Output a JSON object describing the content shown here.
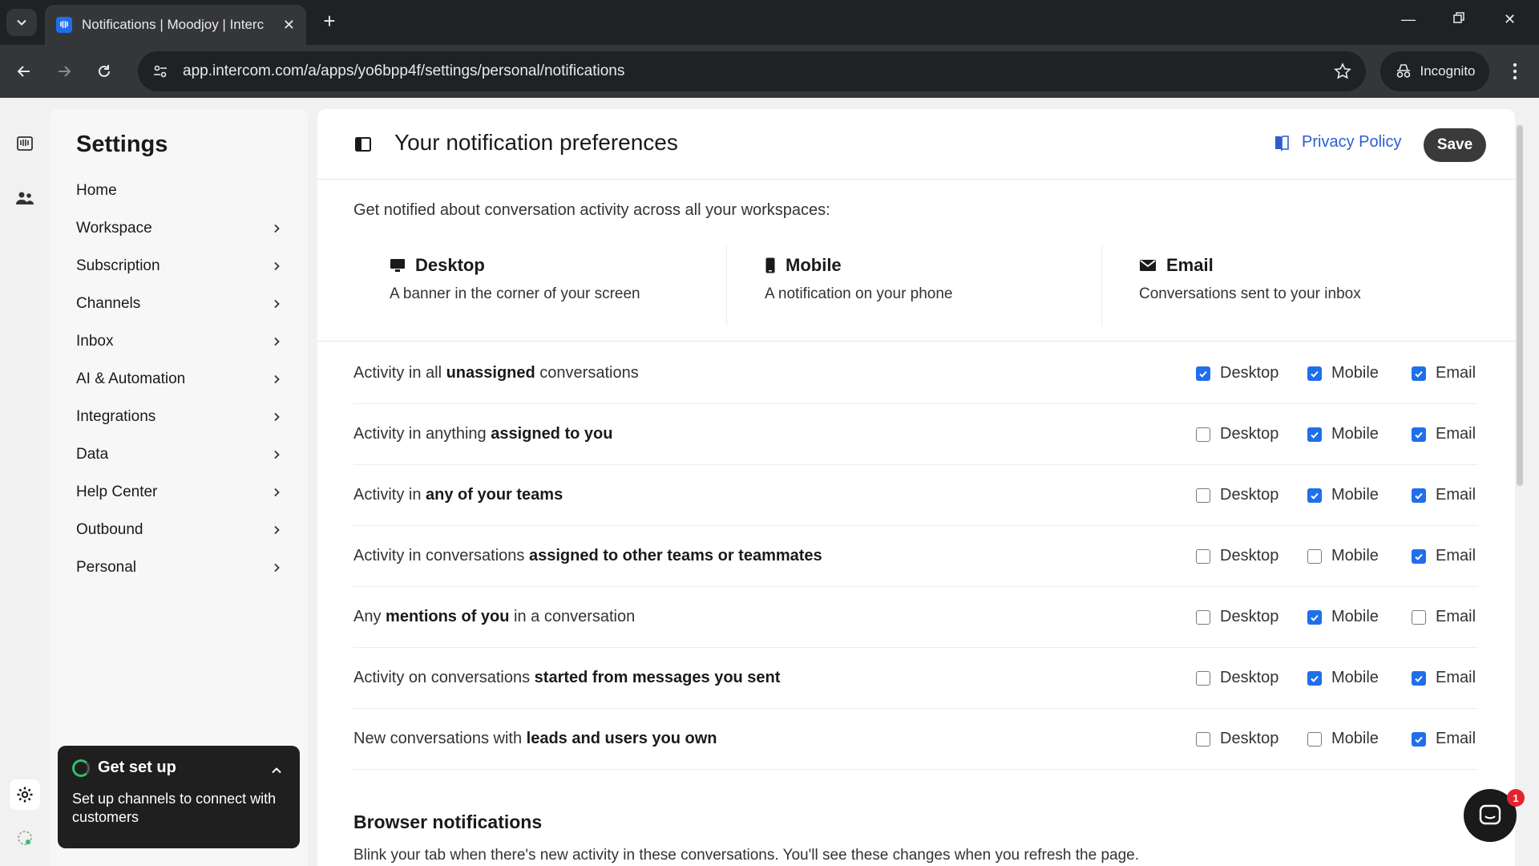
{
  "browser": {
    "tab_title": "Notifications | Moodjoy | Interc",
    "url": "app.intercom.com/a/apps/yo6bpp4f/settings/personal/notifications",
    "incognito_label": "Incognito"
  },
  "sidebar": {
    "title": "Settings",
    "items": [
      {
        "label": "Home"
      },
      {
        "label": "Workspace"
      },
      {
        "label": "Subscription"
      },
      {
        "label": "Channels"
      },
      {
        "label": "Inbox"
      },
      {
        "label": "AI & Automation"
      },
      {
        "label": "Integrations"
      },
      {
        "label": "Data"
      },
      {
        "label": "Help Center"
      },
      {
        "label": "Outbound"
      },
      {
        "label": "Personal"
      }
    ],
    "setup": {
      "title": "Get set up",
      "description": "Set up channels to connect with customers"
    }
  },
  "main": {
    "title": "Your notification preferences",
    "privacy_label": "Privacy Policy",
    "save_label": "Save",
    "intro": "Get notified about conversation activity across all your workspaces:",
    "channels": [
      {
        "title": "Desktop",
        "description": "A banner in the corner of your screen"
      },
      {
        "title": "Mobile",
        "description": "A notification on your phone"
      },
      {
        "title": "Email",
        "description": "Conversations sent to your inbox"
      }
    ],
    "option_labels": {
      "desktop": "Desktop",
      "mobile": "Mobile",
      "email": "Email"
    },
    "rows": [
      {
        "pre": "Activity in all ",
        "bold": "unassigned",
        "post": " conversations",
        "desktop": true,
        "mobile": true,
        "email": true
      },
      {
        "pre": "Activity in anything ",
        "bold": "assigned to you",
        "post": "",
        "desktop": false,
        "mobile": true,
        "email": true
      },
      {
        "pre": "Activity in ",
        "bold": "any of your teams",
        "post": "",
        "desktop": false,
        "mobile": true,
        "email": true
      },
      {
        "pre": "Activity in conversations ",
        "bold": "assigned to other teams or teammates",
        "post": "",
        "desktop": false,
        "mobile": false,
        "email": true
      },
      {
        "pre": "Any ",
        "bold": "mentions of you",
        "post": " in a conversation",
        "desktop": false,
        "mobile": true,
        "email": false
      },
      {
        "pre": "Activity on conversations ",
        "bold": "started from messages you sent",
        "post": "",
        "desktop": false,
        "mobile": true,
        "email": true
      },
      {
        "pre": "New conversations with ",
        "bold": "leads and users you own",
        "post": "",
        "desktop": false,
        "mobile": false,
        "email": true
      }
    ],
    "browser_notifications": {
      "title": "Browser notifications",
      "description": "Blink your tab when there's new activity in these conversations. You'll see these changes when you refresh the page."
    }
  },
  "messenger": {
    "badge": "1"
  },
  "colors": {
    "accent": "#1f6feb",
    "link": "#2c5ecf",
    "badge": "#e5222e"
  }
}
